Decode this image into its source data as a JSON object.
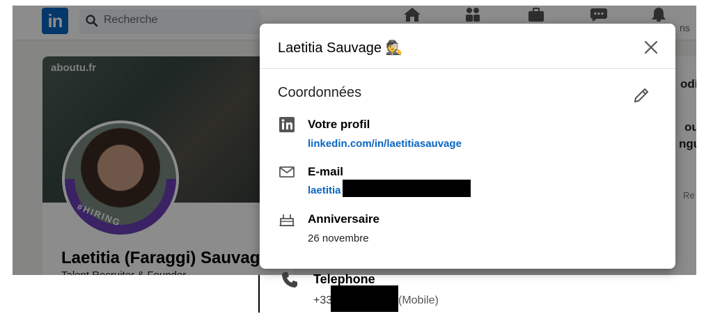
{
  "background": {
    "search_placeholder": "Recherche",
    "logo_text": "in",
    "nav_label_partial": "ns",
    "cover_text": "aboutu.fr",
    "hiring_text": "#HIRING",
    "profile_name": "Laetitia (Faraggi) Sauvag",
    "profile_subtitle": "Talent Recruiter & Founder",
    "right_col_texts": [
      "odifi",
      "oute",
      "ngue",
      "Re"
    ]
  },
  "modal": {
    "title": "Laetitia Sauvage 🕵",
    "section_title": "Coordonnées",
    "profile": {
      "label": "Votre profil",
      "url": "linkedin.com/in/laetitiasauvage"
    },
    "email": {
      "label": "E-mail",
      "value_visible": "laetitia"
    },
    "birthday": {
      "label": "Anniversaire",
      "value": "26 novembre"
    }
  },
  "phone": {
    "label": "Telephone",
    "prefix": "+33",
    "suffix": "(Mobile)"
  },
  "colors": {
    "linkedin_blue": "#0a66c2",
    "hiring_purple": "#6b3fb6"
  }
}
